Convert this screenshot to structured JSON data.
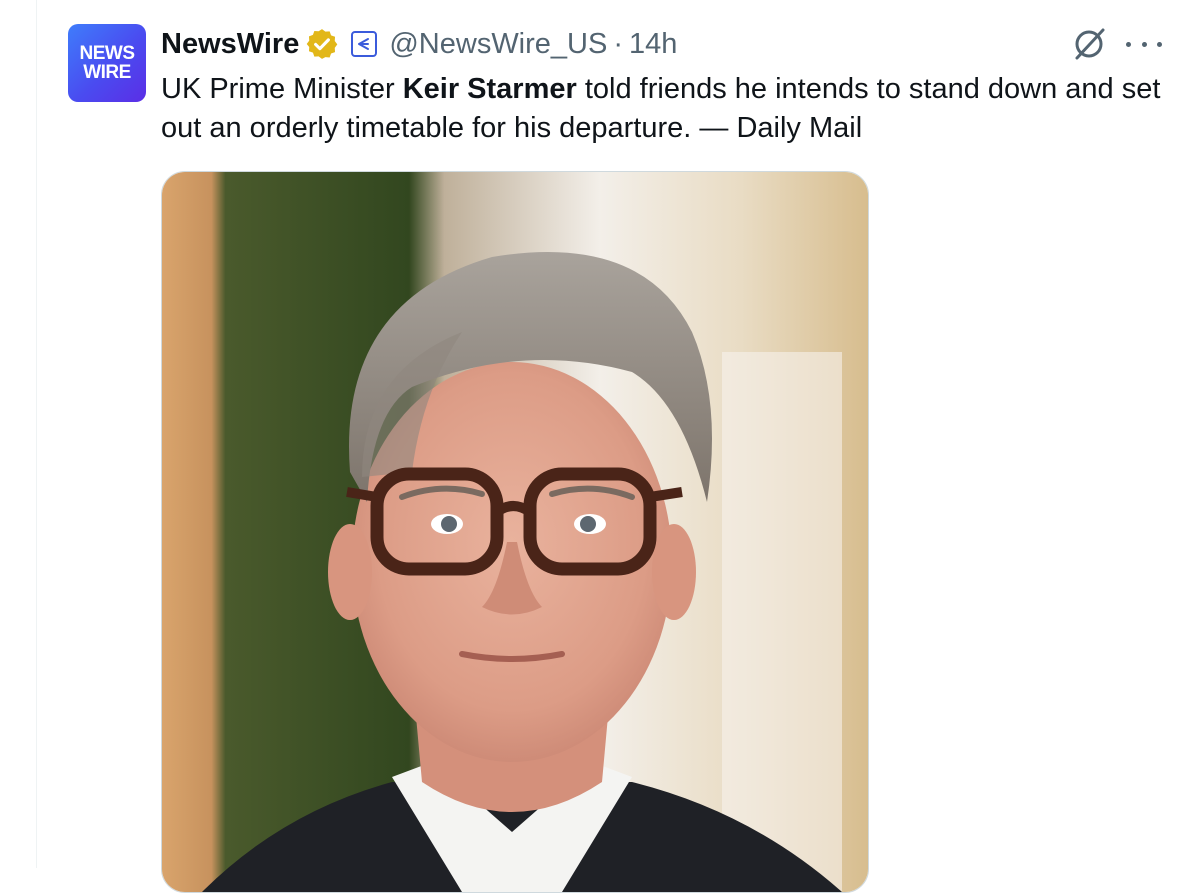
{
  "account": {
    "avatar_line1": "NEWS",
    "avatar_line2": "WIRE",
    "display_name": "NewsWire",
    "handle": "@NewsWire_US",
    "separator": "·",
    "time": "14h",
    "verified_badge": "gold-verified-badge-icon",
    "affiliate_badge": "affiliate-badge-icon"
  },
  "post": {
    "text_before": "UK Prime Minister ",
    "text_bold": "Keir Starmer",
    "text_after": " told friends he intends to stand down and set out an orderly timetable for his departure. — Daily Mail"
  },
  "actions": {
    "grok_icon": "grok-icon",
    "more_icon": "more-options-icon"
  },
  "colors": {
    "avatar_gradient_start": "#3f7dfb",
    "avatar_gradient_end": "#5b2ee6",
    "verified_gold": "#e2b719",
    "secondary_text": "#536471",
    "border": "#cfd9de"
  }
}
